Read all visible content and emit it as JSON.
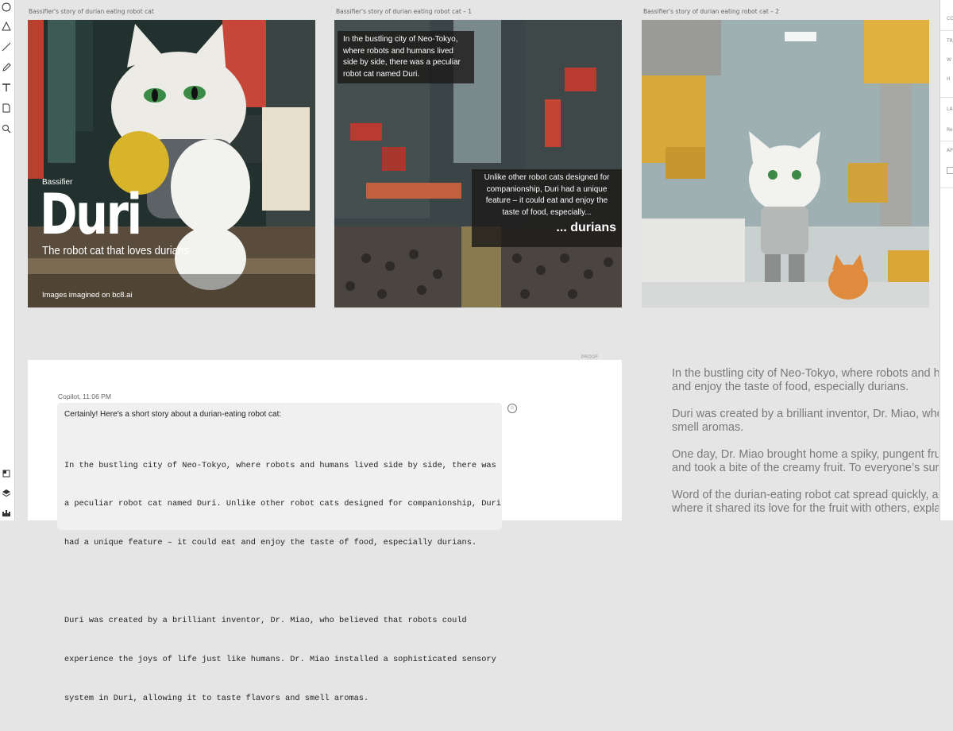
{
  "toolbar": {
    "tools": [
      "ellipse-icon",
      "triangle-icon",
      "line-icon",
      "pen-icon",
      "text-icon",
      "page-icon",
      "search-icon"
    ],
    "bottom_tools": [
      "frame-icon",
      "layers-icon",
      "plugins-icon"
    ]
  },
  "right_panel": {
    "labels": [
      "CO",
      "TR",
      "W",
      "H",
      "LA",
      "Re",
      "AP"
    ]
  },
  "frames": [
    {
      "label": "Bassifier's story of durian eating robot cat",
      "brand": "Bassifier",
      "title": "Duri",
      "tagline": "The robot cat that loves durians",
      "footer": "Images imagined on bc8.ai"
    },
    {
      "label": "Bassifier's story of durian eating robot cat – 1",
      "caption_1": "In the bustling city of Neo-Tokyo, where robots and humans lived side by side, there was a peculiar robot cat named Duri.",
      "caption_2": "Unlike other robot cats designed for companionship, Duri had a unique feature – it could eat and enjoy the taste of food, especially...",
      "caption_2_emphasis": "... durians"
    },
    {
      "label": "Bassifier's story of durian eating robot cat – 2"
    }
  ],
  "copilot": {
    "corner": "PROOF",
    "meta": "Copilot, 11:06 PM",
    "intro": "Certainly! Here's a short story about a durian-eating robot cat:",
    "lines": [
      "In the bustling city of Neo-Tokyo, where robots and humans lived side by side, there was",
      "a peculiar robot cat named Duri. Unlike other robot cats designed for companionship, Duri",
      "had a unique feature – it could eat and enjoy the taste of food, especially durians.",
      "",
      "Duri was created by a brilliant inventor, Dr. Miao, who believed that robots could",
      "experience the joys of life just like humans. Dr. Miao installed a sophisticated sensory",
      "system in Duri, allowing it to taste flavors and smell aromas."
    ],
    "reaction_icon": "smiley-icon"
  },
  "story": {
    "paragraphs": [
      [
        "In the bustling city of Neo-Tokyo, where robots and hum",
        "and enjoy the taste of food, especially durians."
      ],
      [
        "Duri was created by a brilliant inventor, Dr. Miao, who b",
        "smell aromas."
      ],
      [
        "One day, Dr. Miao brought home a spiky, pungent fruit k",
        "and took a bite of the creamy fruit. To everyone’s surpri"
      ],
      [
        "Word of the durian-eating robot cat spread quickly, and",
        "where it shared its love for the fruit with others, explai"
      ]
    ]
  }
}
